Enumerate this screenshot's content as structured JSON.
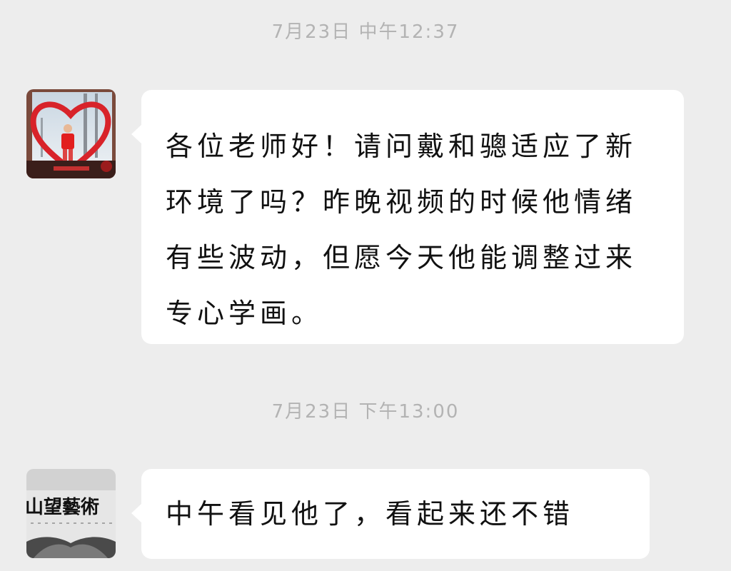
{
  "messages": [
    {
      "timestamp": "7月23日  中午12:37",
      "text": "各位老师好！请问戴和骢适应了新环境了吗？昨晚视频的时候他情绪有些波动，但愿今天他能调整过来专心学画。",
      "avatar": "child-photo-heart-frame"
    },
    {
      "timestamp": "7月23日  下午13:00",
      "text": "中午看见他了，看起来还不错",
      "avatar": "art-studio-logo",
      "avatar_sign_text": "山望藝術"
    }
  ],
  "colors": {
    "background": "#ededed",
    "bubble": "#ffffff",
    "timestamp": "#b3b3b3",
    "text": "#111111",
    "heart": "#d8232a"
  }
}
